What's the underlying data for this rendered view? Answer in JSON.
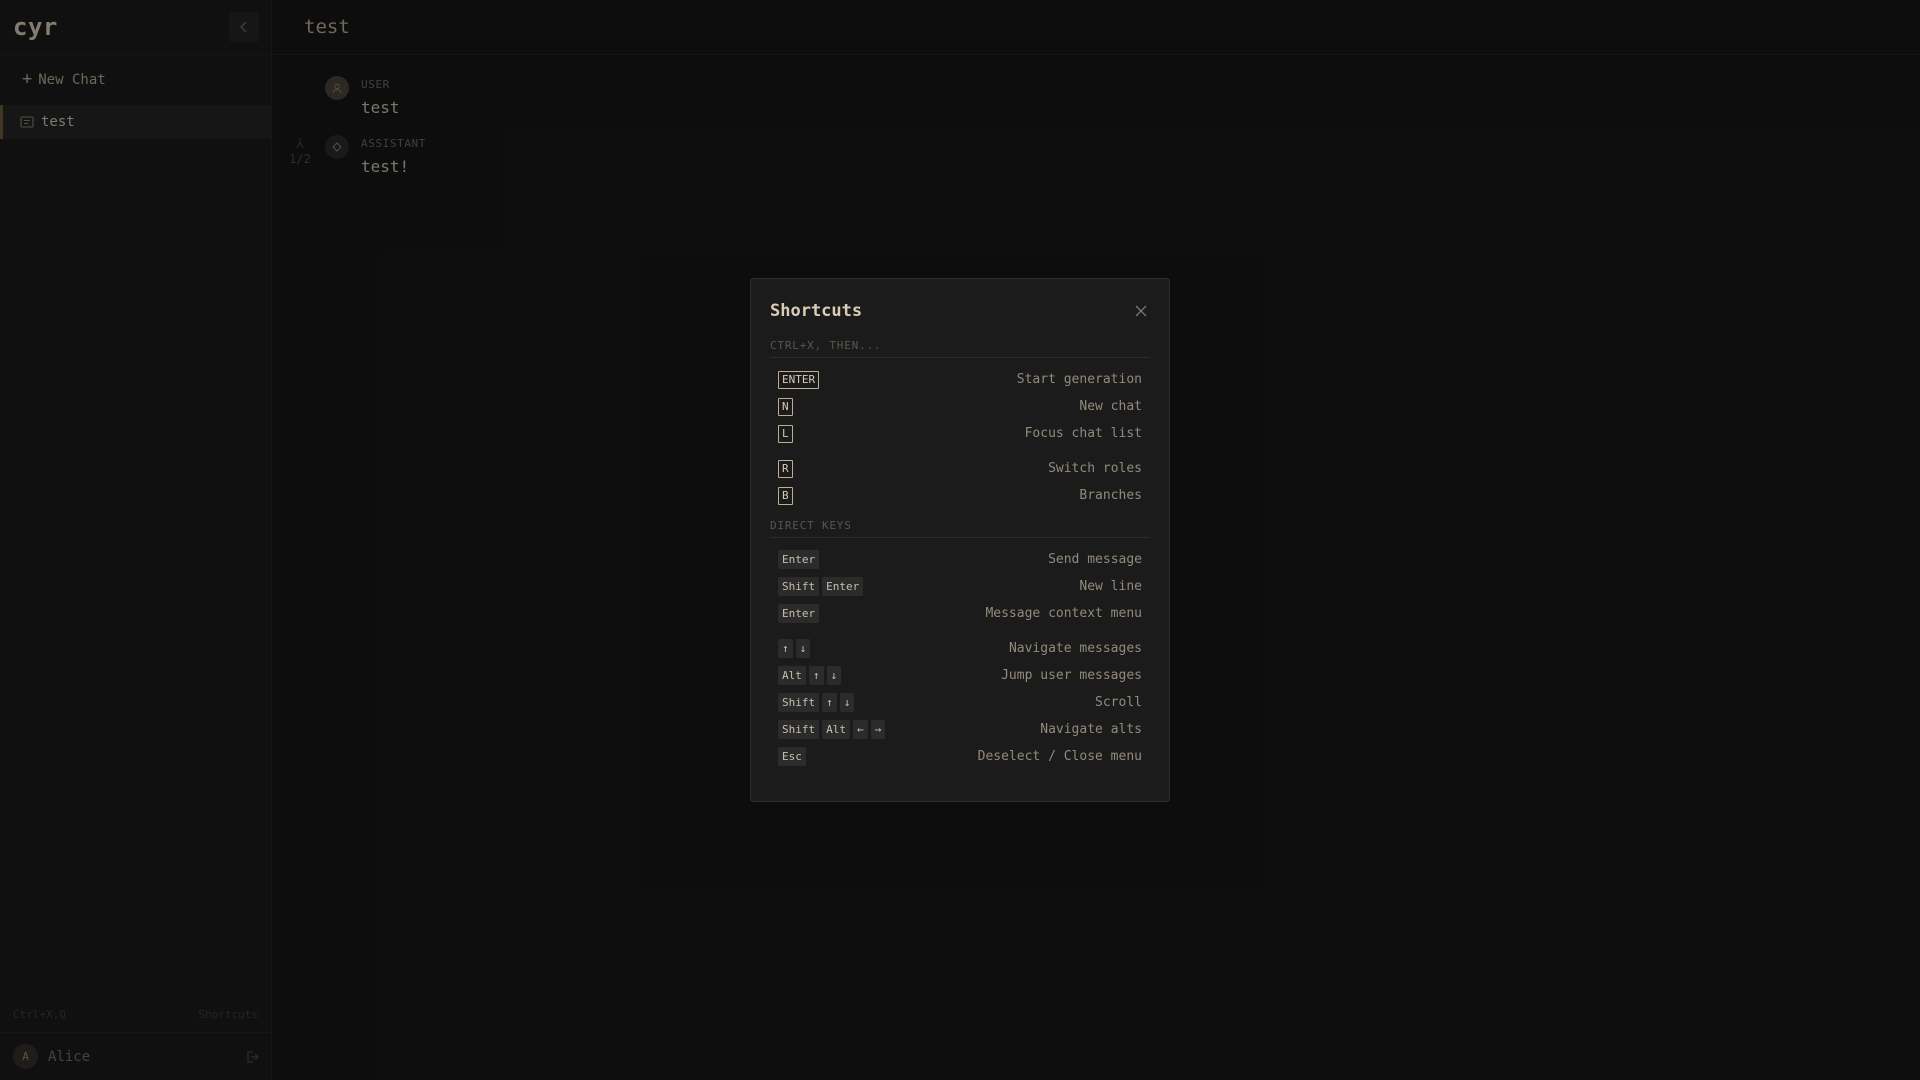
{
  "app": {
    "logo": "cyr"
  },
  "sidebar": {
    "new_chat_label": "New Chat",
    "chats": [
      {
        "label": "test",
        "active": true
      }
    ],
    "hint_left": "Ctrl+X,Q",
    "hint_right": "Shortcuts",
    "user": {
      "initial": "A",
      "name": "Alice"
    }
  },
  "chat": {
    "title": "test",
    "messages": [
      {
        "role": "USER",
        "text": "test"
      },
      {
        "role": "ASSISTANT",
        "text": "test!"
      }
    ],
    "branch": {
      "position": "1/2"
    }
  },
  "shortcuts": {
    "title": "Shortcuts",
    "sections": [
      {
        "label": "CTRL+X, THEN...",
        "items": [
          {
            "keys": [
              "ENTER"
            ],
            "action": "Start generation"
          },
          {
            "keys": [
              "N"
            ],
            "action": "New chat"
          },
          {
            "keys": [
              "L"
            ],
            "action": "Focus chat list"
          },
          {
            "keys": [
              "R"
            ],
            "action": "Switch roles"
          },
          {
            "keys": [
              "B"
            ],
            "action": "Branches"
          }
        ]
      },
      {
        "label": "DIRECT KEYS",
        "items": [
          {
            "keys": [
              "Enter"
            ],
            "action": "Send message"
          },
          {
            "keys": [
              "Shift",
              "Enter"
            ],
            "action": "New line"
          },
          {
            "keys": [
              "Enter"
            ],
            "action": "Message context menu"
          },
          {
            "keys": [
              "↑",
              "↓"
            ],
            "action": "Navigate messages"
          },
          {
            "keys": [
              "Alt",
              "↑",
              "↓"
            ],
            "action": "Jump user messages"
          },
          {
            "keys": [
              "Shift",
              "↑",
              "↓"
            ],
            "action": "Scroll"
          },
          {
            "keys": [
              "Shift",
              "Alt",
              "←",
              "→"
            ],
            "action": "Navigate alts"
          },
          {
            "keys": [
              "Esc"
            ],
            "action": "Deselect / Close menu"
          }
        ]
      }
    ]
  },
  "colors": {
    "accent": "#bcae92",
    "background": "#171717",
    "sidebar": "#1c1c1c"
  }
}
